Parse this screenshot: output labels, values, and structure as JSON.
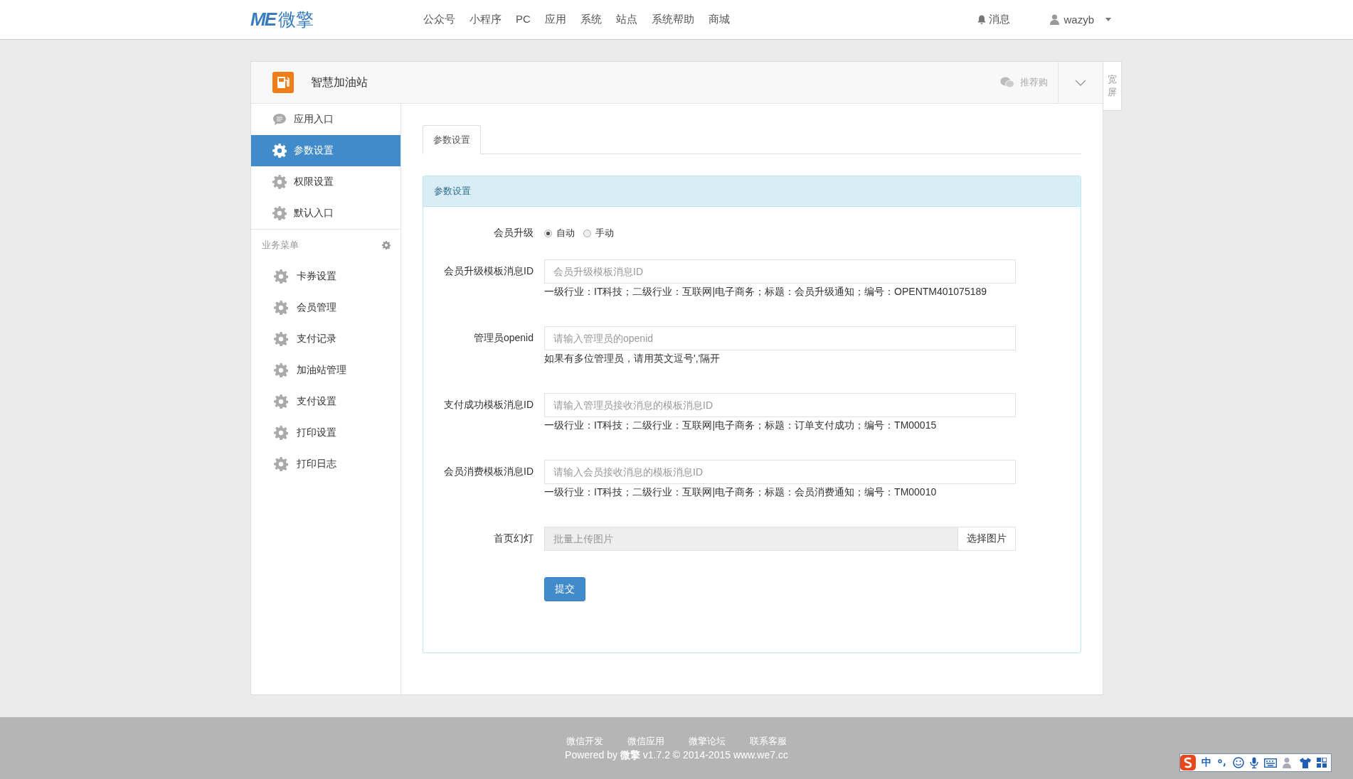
{
  "header": {
    "logo_mark": "ME",
    "logo_name": "微擎",
    "nav": [
      "公众号",
      "小程序",
      "PC",
      "应用",
      "系统",
      "站点",
      "系统帮助",
      "商城"
    ],
    "messages": "消息",
    "user": "wazyb"
  },
  "app": {
    "title": "智慧加油站",
    "share": "推荐购",
    "wide_screen": "宽屏"
  },
  "sidebar": {
    "items": [
      {
        "label": "应用入口",
        "kind": "comment",
        "selected": false
      },
      {
        "label": "参数设置",
        "kind": "gear",
        "selected": true
      },
      {
        "label": "权限设置",
        "kind": "gear",
        "selected": false
      },
      {
        "label": "默认入口",
        "kind": "gear",
        "selected": false
      }
    ],
    "section": "业务菜单",
    "section_items": [
      {
        "label": "卡券设置",
        "selected": false
      },
      {
        "label": "会员管理",
        "selected": false
      },
      {
        "label": "支付记录",
        "selected": false
      },
      {
        "label": "加油站管理",
        "selected": false
      },
      {
        "label": "支付设置",
        "selected": false
      },
      {
        "label": "打印设置",
        "selected": false
      },
      {
        "label": "打印日志",
        "selected": false
      }
    ]
  },
  "tabs": [
    {
      "label": "参数设置",
      "selected": true
    }
  ],
  "form": {
    "heading": "参数设置",
    "fields": [
      {
        "kind": "radio",
        "label": "会员升级",
        "options": [
          {
            "label": "自动",
            "selected": true
          },
          {
            "label": "手动",
            "selected": false
          }
        ]
      },
      {
        "kind": "text",
        "label": "会员升级模板消息ID",
        "placeholder": "会员升级模板消息ID",
        "help": "一级行业：IT科技；二级行业：互联网|电子商务；标题：会员升级通知；编号：OPENTM401075189"
      },
      {
        "kind": "text",
        "label": "管理员openid",
        "placeholder": "请输入管理员的openid",
        "help": "如果有多位管理员，请用英文逗号','隔开"
      },
      {
        "kind": "text",
        "label": "支付成功模板消息ID",
        "placeholder": "请输入管理员接收消息的模板消息ID",
        "help": "一级行业：IT科技；二级行业：互联网|电子商务；标题：订单支付成功；编号：TM00015"
      },
      {
        "kind": "text",
        "label": "会员消费模板消息ID",
        "placeholder": "请输入会员接收消息的模板消息ID",
        "help": "一级行业：IT科技；二级行业：互联网|电子商务；标题：会员消费通知；编号：TM00010"
      },
      {
        "kind": "upload",
        "label": "首页幻灯",
        "placeholder": "批量上传图片",
        "button": "选择图片"
      }
    ],
    "submit": "提交"
  },
  "footer": {
    "links": [
      "微信开发",
      "微信应用",
      "微擎论坛",
      "联系客服"
    ],
    "powered_prefix": "Powered by ",
    "powered_brand": "微擎",
    "powered_suffix": " v1.7.2 © 2014-2015 www.we7.cc"
  },
  "ime": {
    "mode": "中"
  }
}
